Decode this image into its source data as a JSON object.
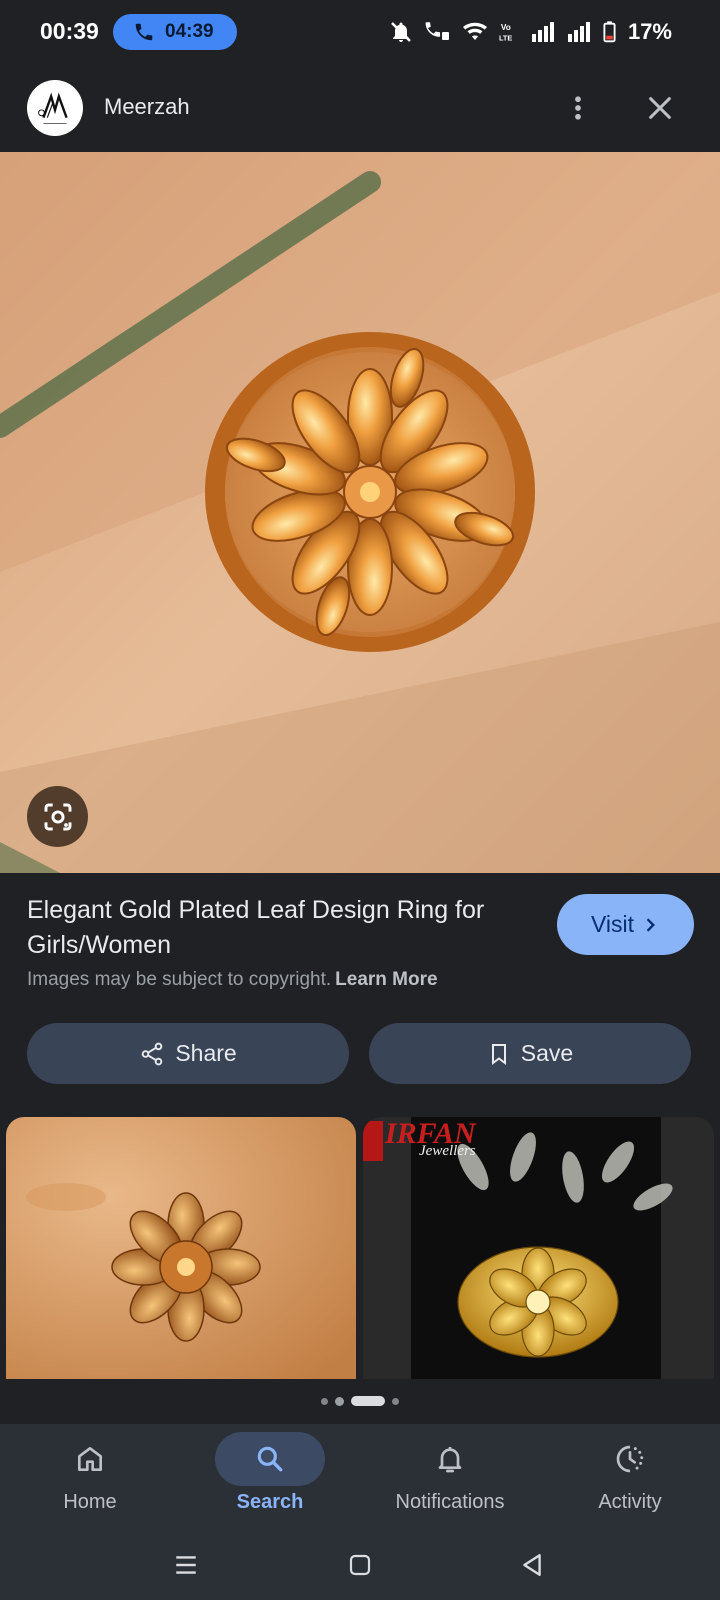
{
  "status_bar": {
    "time": "00:39",
    "call_duration": "04:39",
    "battery": "17%",
    "icons": [
      "phone-icon",
      "mute-icon",
      "wifi-call-icon",
      "wifi-icon",
      "volte-icon",
      "signal-icon",
      "signal-icon",
      "battery-icon"
    ]
  },
  "header": {
    "site_name": "Meerzah",
    "avatar_icon": "meerzah-logo-icon",
    "more_icon": "more-vert-icon",
    "close_icon": "close-icon"
  },
  "main_image": {
    "alt": "gold ring",
    "lens_icon": "google-lens-icon"
  },
  "info": {
    "title": "Elegant Gold Plated Leaf Design Ring for Girls/Women",
    "visit_label": "Visit",
    "copyright_text": "Images may be subject to copyright.",
    "learn_more": "Learn More"
  },
  "actions": {
    "share_label": "Share",
    "save_label": "Save"
  },
  "related": {
    "brand_text": "IRFAN",
    "brand_sub": "Jewellers"
  },
  "pagination": {
    "count": 4,
    "active": 2
  },
  "bottom_nav": {
    "items": [
      {
        "label": "Home",
        "icon": "home-icon"
      },
      {
        "label": "Search",
        "icon": "search-icon",
        "active": true
      },
      {
        "label": "Notifications",
        "icon": "bell-icon"
      },
      {
        "label": "Activity",
        "icon": "activity-icon"
      }
    ]
  },
  "colors": {
    "background": "#202124",
    "accent": "#8ab4f8",
    "button_bg": "#394457"
  }
}
